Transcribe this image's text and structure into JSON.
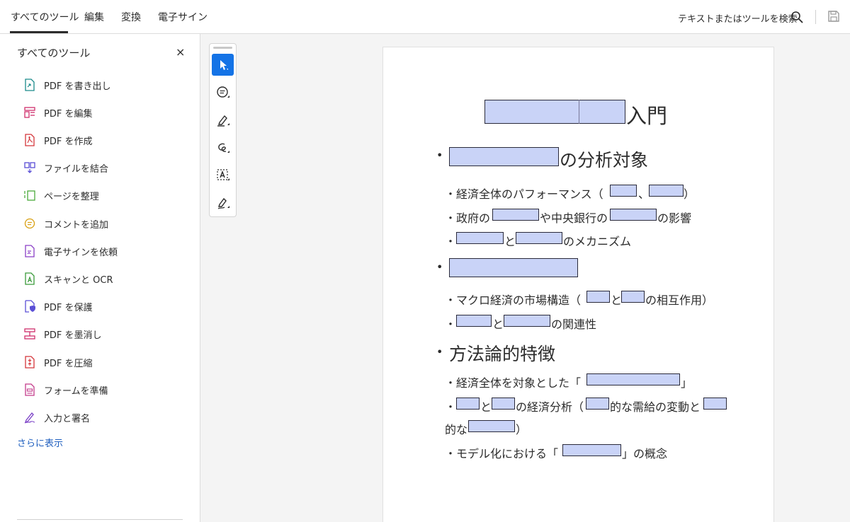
{
  "tabs": [
    "すべてのツール",
    "編集",
    "変換",
    "電子サイン"
  ],
  "search": {
    "label": "テキストまたはツールを検索"
  },
  "panel": {
    "title": "すべてのツール",
    "close": "×",
    "tools": [
      {
        "label": "PDF を書き出し",
        "icon": "export-pdf-icon",
        "color": "#1a8a8a"
      },
      {
        "label": "PDF を編集",
        "icon": "edit-pdf-icon",
        "color": "#d0306c"
      },
      {
        "label": "PDF を作成",
        "icon": "create-pdf-icon",
        "color": "#d4353a"
      },
      {
        "label": "ファイルを結合",
        "icon": "combine-files-icon",
        "color": "#5a4fd6"
      },
      {
        "label": "ページを整理",
        "icon": "organize-pages-icon",
        "color": "#4caa3c"
      },
      {
        "label": "コメントを追加",
        "icon": "comment-icon",
        "color": "#d9a013"
      },
      {
        "label": "電子サインを依頼",
        "icon": "request-esign-icon",
        "color": "#8a3fc6"
      },
      {
        "label": "スキャンと OCR",
        "icon": "scan-ocr-icon",
        "color": "#3a9a3a"
      },
      {
        "label": "PDF を保護",
        "icon": "protect-pdf-icon",
        "color": "#5a4fd6"
      },
      {
        "label": "PDF を墨消し",
        "icon": "redact-pdf-icon",
        "color": "#d0306c"
      },
      {
        "label": "PDF を圧縮",
        "icon": "compress-pdf-icon",
        "color": "#d4353a"
      },
      {
        "label": "フォームを準備",
        "icon": "prepare-form-icon",
        "color": "#c43a8a"
      },
      {
        "label": "入力と署名",
        "icon": "fill-sign-icon",
        "color": "#7a3fc6"
      }
    ],
    "more": "さらに表示"
  },
  "toolstrip": [
    "select-icon",
    "comment-icon",
    "highlight-icon",
    "draw-icon",
    "text-select-icon",
    "sign-icon"
  ],
  "doc": {
    "title": "入門",
    "h1": "の分析対象",
    "b1_1_prefix": "・経済全体のパフォーマンス（",
    "b1_1_sep": "、",
    "b1_1_end": "）",
    "b1_2_prefix": "・政府の",
    "b1_2_mid": "や中央銀行の",
    "b1_2_end": "の影響",
    "b1_3_prefix": "・",
    "b1_3_mid": "と",
    "b1_3_end": "のメカニズム",
    "b2_1_prefix": "・マクロ経済の市場構造（",
    "b2_1_mid": "と",
    "b2_1_end": "の相互作用）",
    "b2_2_prefix": "・",
    "b2_2_mid": "と",
    "b2_2_end": "の関連性",
    "h3": "方法論的特徴",
    "b3_1_prefix": "・経済全体を対象とした「",
    "b3_1_end": "」",
    "b3_2_prefix": "・",
    "b3_2_mid": "と",
    "b3_2_a": "の経済分析（",
    "b3_2_b": "的な需給の変動と",
    "b3_2c_prefix": "的な",
    "b3_2c_end": "）",
    "b3_3_prefix": "・モデル化における「",
    "b3_3_end": "」の概念",
    "bullet": "•"
  }
}
